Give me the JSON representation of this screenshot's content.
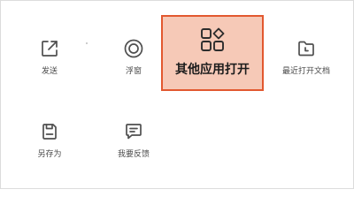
{
  "menu": {
    "items": [
      {
        "label": "发送",
        "icon": "share-icon"
      },
      {
        "label": "浮窗",
        "icon": "floating-window-icon"
      },
      {
        "label": "其他应用打开",
        "icon": "apps-icon"
      },
      {
        "label": "最近打开文档",
        "icon": "recent-document-icon"
      },
      {
        "label": "另存为",
        "icon": "save-as-icon"
      },
      {
        "label": "我要反馈",
        "icon": "feedback-icon"
      }
    ]
  },
  "highlight": {
    "index": 2,
    "border_color": "#e2582f",
    "fill_color": "#f6c9b7"
  }
}
